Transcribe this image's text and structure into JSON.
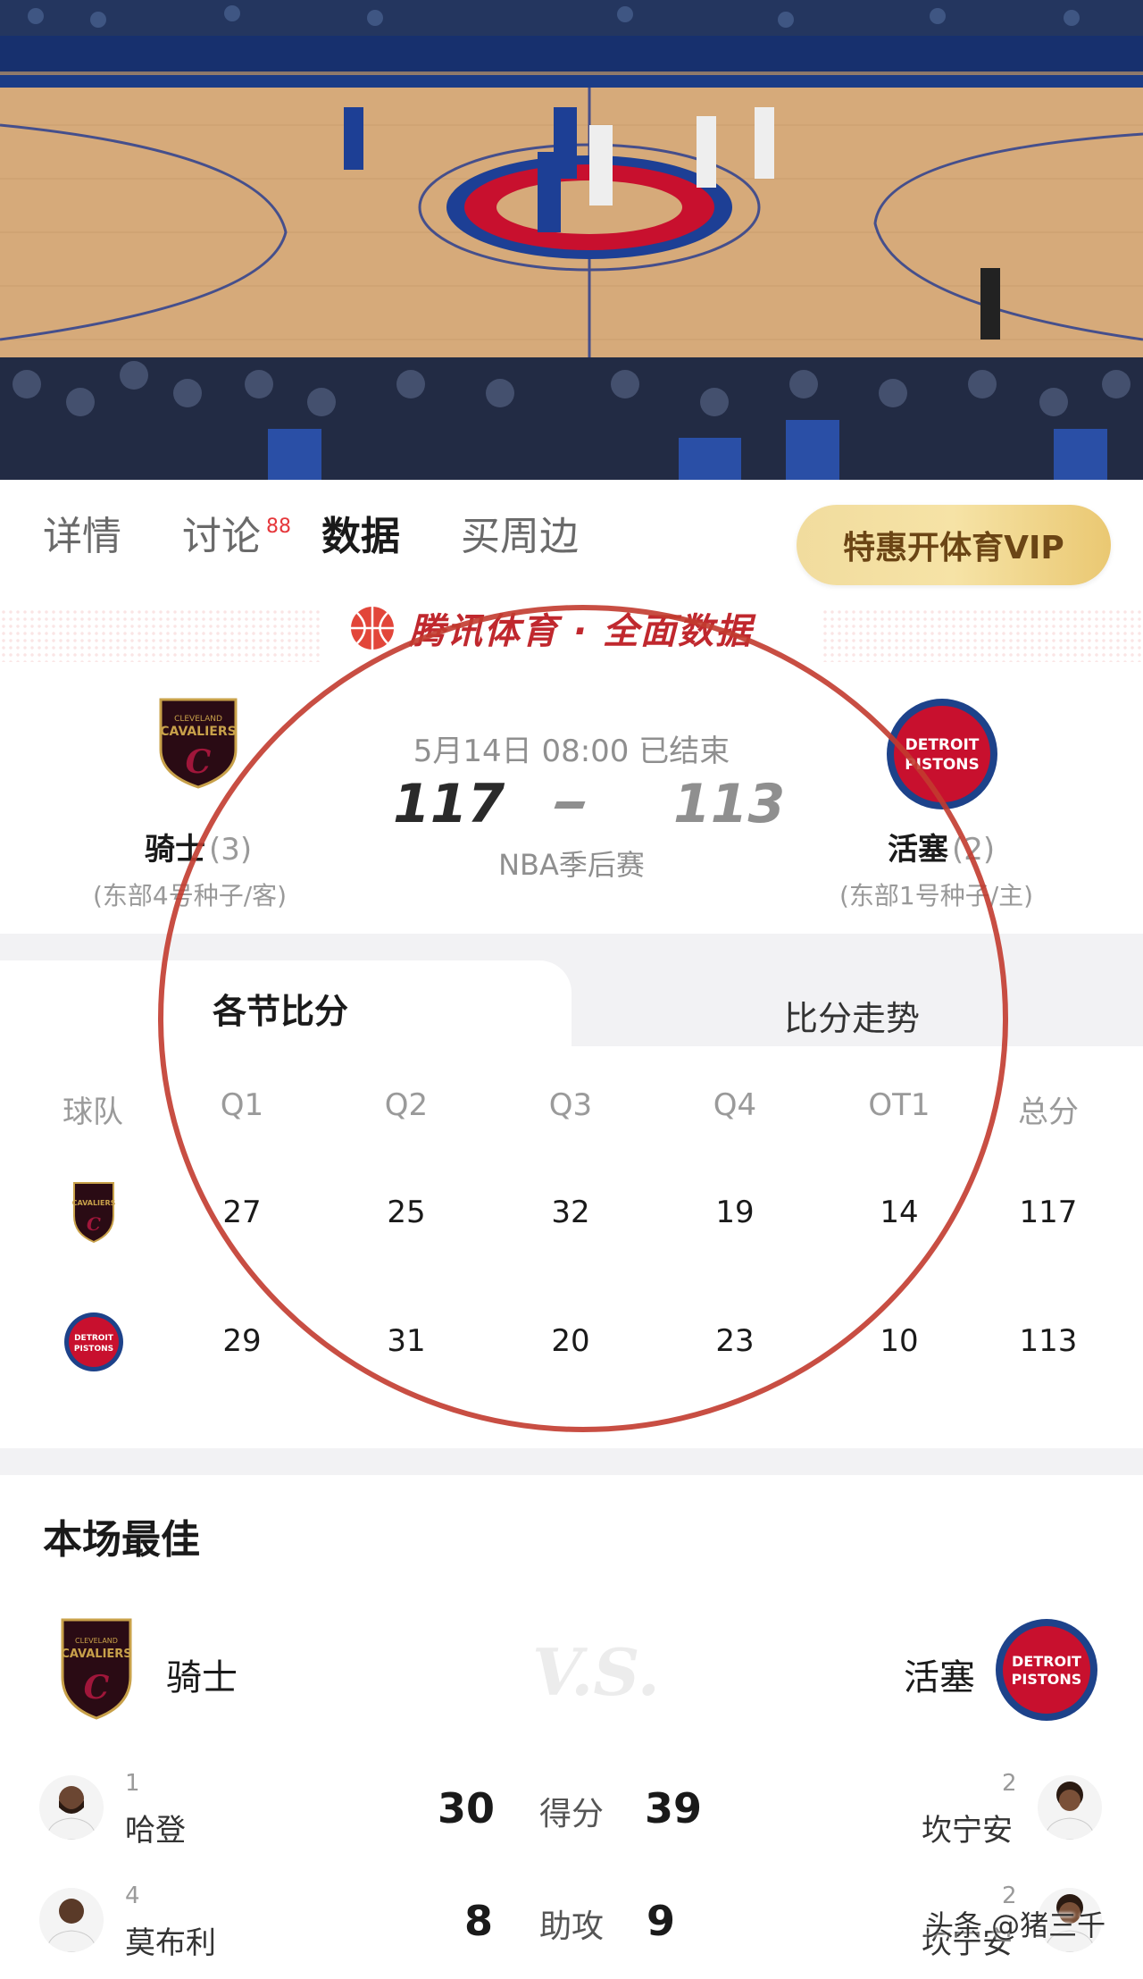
{
  "tabs": {
    "items": [
      {
        "label": "详情"
      },
      {
        "label": "讨论"
      },
      {
        "label": "数据"
      },
      {
        "label": "买周边"
      }
    ],
    "discussion_badge": "88",
    "active": "数据",
    "vip_button": "特惠开体育VIP"
  },
  "brand": {
    "title": "腾讯体育 · 全面数据"
  },
  "match": {
    "datetime": "5月14日 08:00",
    "status": "已结束",
    "type": "NBA季后赛",
    "away": {
      "name": "骑士",
      "record": "(3)",
      "seed": "(东部4号种子/客)",
      "score": "117",
      "logo_text_top": "CLEVELAND",
      "logo_text_main": "CAVALIERS",
      "color": "#860038"
    },
    "home": {
      "name": "活塞",
      "record": "(2)",
      "seed": "(东部1号种子/主)",
      "score": "113",
      "logo_text_top": "DETROIT",
      "logo_text_main": "PISTONS",
      "color": "#c8102e"
    },
    "dash": "–"
  },
  "quarters": {
    "tabs": {
      "active": "各节比分",
      "inactive": "比分走势"
    },
    "headers": [
      "球队",
      "Q1",
      "Q2",
      "Q3",
      "Q4",
      "OT1",
      "总分"
    ],
    "rows": [
      {
        "team": "骑士",
        "scores": [
          "27",
          "25",
          "32",
          "19",
          "14",
          "117"
        ]
      },
      {
        "team": "活塞",
        "scores": [
          "29",
          "31",
          "20",
          "23",
          "10",
          "113"
        ]
      }
    ]
  },
  "best": {
    "title": "本场最佳",
    "vs": "V.S.",
    "left_team": "骑士",
    "right_team": "活塞",
    "rows": [
      {
        "label": "得分",
        "left": {
          "rank": "1",
          "name": "哈登",
          "value": "30"
        },
        "right": {
          "rank": "2",
          "name": "坎宁安",
          "value": "39"
        }
      },
      {
        "label": "助攻",
        "left": {
          "rank": "4",
          "name": "莫布利",
          "value": "8"
        },
        "right": {
          "rank": "2",
          "name": "坎宁安",
          "value": "9"
        }
      }
    ]
  },
  "watermark": "头条 @猪三千",
  "colors": {
    "accent_red": "#c0282e",
    "vip_gold": "#f1dc9e",
    "annotation": "#c23b2f"
  }
}
